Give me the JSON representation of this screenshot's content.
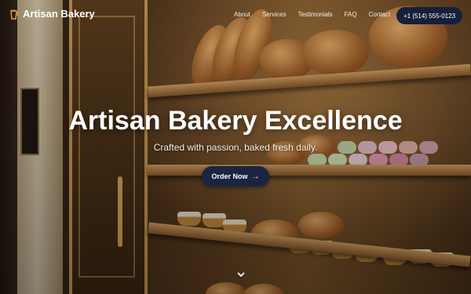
{
  "nav": {
    "brand": "Artisan Bakery",
    "brand_icon": "cup-icon",
    "links": [
      "About",
      "Services",
      "Testimonials",
      "FAQ",
      "Contact"
    ],
    "phone": "+1 (514) 555-0123"
  },
  "hero": {
    "title": "Artisan Bakery Excellence",
    "subtitle": "Crafted with passion, baked fresh daily.",
    "cta_label": "Order Now",
    "cta_icon": "arrow-right-icon",
    "scroll_icon": "chevron-down-icon"
  },
  "colors": {
    "navy": "#16203a",
    "accent_gold": "#d6a95a"
  }
}
